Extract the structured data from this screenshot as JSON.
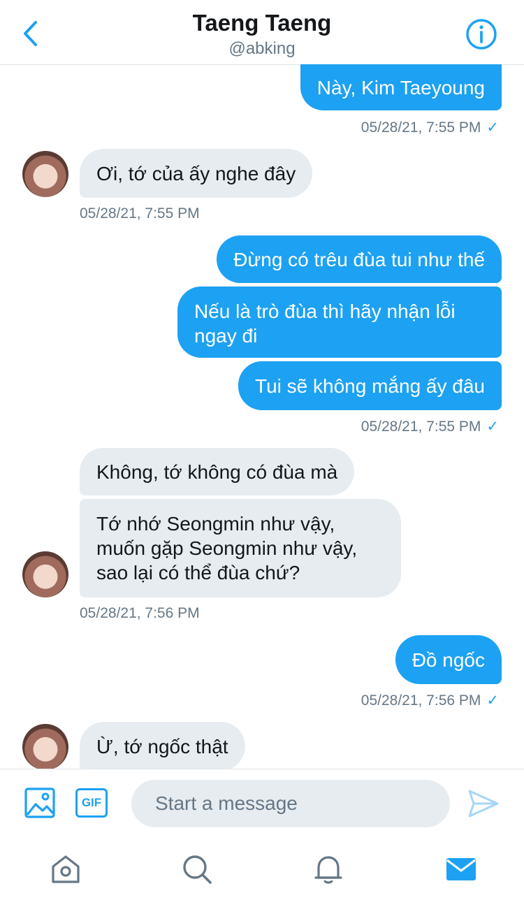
{
  "header": {
    "title": "Taeng Taeng",
    "handle": "@abking"
  },
  "messages": [
    {
      "dir": "out",
      "text": "Này, Kim Taeyoung"
    },
    {
      "dir": "in",
      "text": "Ơi, tớ của ấy nghe đây"
    },
    {
      "dir": "out",
      "text": "Đừng có trêu đùa tui như thế"
    },
    {
      "dir": "out",
      "text": "Nếu là trò đùa thì hãy nhận lỗi ngay đi"
    },
    {
      "dir": "out",
      "text": "Tui sẽ không mắng ấy đâu"
    },
    {
      "dir": "in",
      "text": "Không, tớ không có đùa mà"
    },
    {
      "dir": "in",
      "text": "Tớ nhớ Seongmin như vậy, muốn gặp Seongmin như vậy, sao lại có thể đùa chứ?"
    },
    {
      "dir": "out",
      "text": "Đồ ngốc"
    },
    {
      "dir": "in",
      "text": "Ừ, tớ ngốc thật"
    }
  ],
  "timestamps": [
    "05/28/21, 7:55 PM",
    "05/28/21, 7:55 PM",
    "05/28/21, 7:55 PM",
    "05/28/21, 7:56 PM",
    "05/28/21, 7:56 PM"
  ],
  "read_check": "✓",
  "composer": {
    "gif_label": "GIF",
    "placeholder": "Start a message"
  },
  "icons": {
    "back": "chevron-left-icon",
    "info": "info-icon",
    "image": "image-icon",
    "gif": "gif-icon",
    "send": "send-icon",
    "home": "home-icon",
    "search": "search-icon",
    "notifications": "bell-icon",
    "messages": "mail-icon"
  },
  "colors": {
    "accent": "#1da1f2",
    "incoming_bubble": "#e6ecf0",
    "muted_text": "#657786"
  }
}
